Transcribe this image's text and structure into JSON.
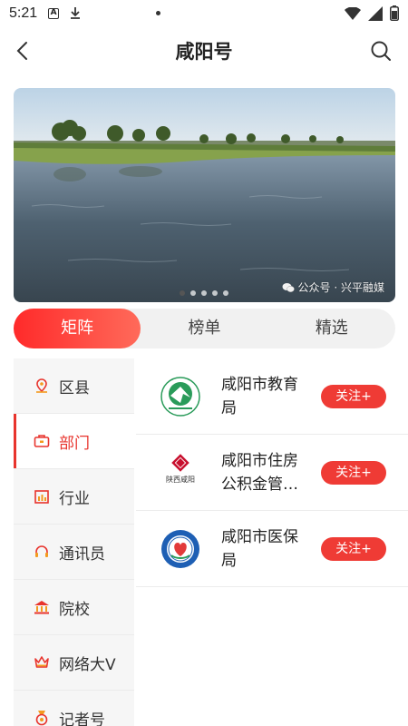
{
  "status_bar": {
    "time": "5:21",
    "icons": [
      "a-icon",
      "download-icon",
      "wifi-icon",
      "signal-icon",
      "battery-icon"
    ]
  },
  "header": {
    "title": "咸阳号",
    "back_icon": "chevron-left-icon",
    "search_icon": "search-icon"
  },
  "banner": {
    "watermark": "公众号 · 兴平融媒",
    "dot_count": 5,
    "active_dot": 1
  },
  "tabs": [
    {
      "label": "矩阵",
      "active": true
    },
    {
      "label": "榜单",
      "active": false
    },
    {
      "label": "精选",
      "active": false
    }
  ],
  "sidebar": {
    "items": [
      {
        "label": "区县",
        "icon": "location-pin-icon",
        "active": false
      },
      {
        "label": "部门",
        "icon": "briefcase-icon",
        "active": true
      },
      {
        "label": "行业",
        "icon": "bar-chart-icon",
        "active": false
      },
      {
        "label": "通讯员",
        "icon": "headset-icon",
        "active": false
      },
      {
        "label": "院校",
        "icon": "school-building-icon",
        "active": false
      },
      {
        "label": "网络大V",
        "icon": "crown-icon",
        "active": false
      },
      {
        "label": "记者号",
        "icon": "medal-icon",
        "active": false
      }
    ]
  },
  "organizations": [
    {
      "name": "咸阳市教育局",
      "follow_label": "关注+",
      "logo": "education-bureau-logo"
    },
    {
      "name": "咸阳市住房公积金管理中心",
      "follow_label": "关注+",
      "logo": "housing-fund-logo",
      "logo_text": "陕西咸阳"
    },
    {
      "name": "咸阳市医保局",
      "follow_label": "关注+",
      "logo": "medical-insurance-logo"
    }
  ],
  "colors": {
    "accent": "#ef3b35",
    "tab_gradient_start": "#ff2a2a",
    "tab_gradient_end": "#ff6a5a",
    "sidebar_bg": "#f6f6f6"
  }
}
